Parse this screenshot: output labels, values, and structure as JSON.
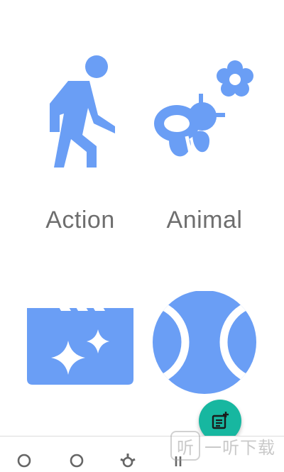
{
  "theme": {
    "icon_color": "#6a9ef5",
    "label_color": "#6e6e6e",
    "fab_color": "#17b7a0"
  },
  "categories": [
    {
      "label": "Action",
      "icon": "person-walking-icon"
    },
    {
      "label": "Animal",
      "icon": "bee-flower-icon"
    },
    {
      "label": "",
      "icon": "movie-clapper-sparkle-icon"
    },
    {
      "label": "",
      "icon": "tennis-ball-icon"
    }
  ],
  "fab": {
    "icon": "add-note-icon"
  },
  "watermark": {
    "logo_text": "听",
    "text": "一听下载"
  }
}
